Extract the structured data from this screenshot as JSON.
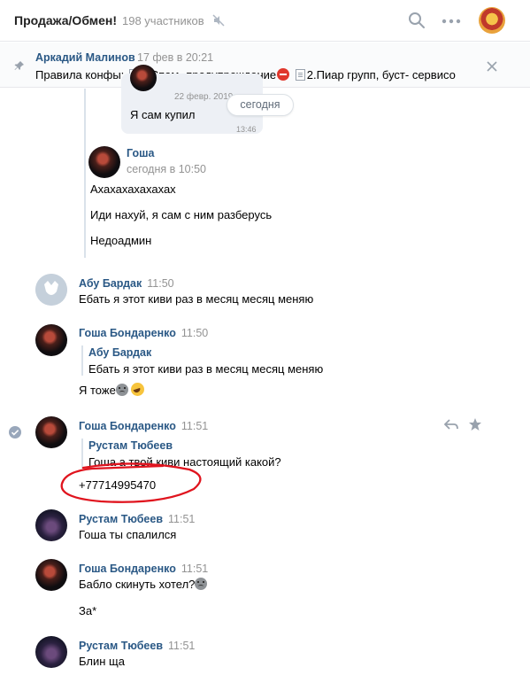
{
  "header": {
    "title": "Продажа/Обмен!",
    "members": "198 участников"
  },
  "pinned": {
    "author": "Аркадий Малинов",
    "date": "17 фев в 20:21",
    "text_prefix": "Правила конфы:",
    "text_part1": "1.Спам- предупреждение",
    "text_part2": "2.Пиар групп, буст- сервисо"
  },
  "quoted_bubble": {
    "date": "22 февр. 2019 г.",
    "text": "Я сам купил",
    "time": "13:46"
  },
  "date_separator": "сегодня",
  "messages": [
    {
      "author": "Гоша",
      "time": "сегодня в 10:50",
      "lines": [
        "Ахахахахахахах",
        "Иди нахуй, я сам с ним разберусь",
        "Недоадмин"
      ]
    },
    {
      "author": "Абу Бардак",
      "time": "11:50",
      "text": "Ебать я этот киви раз в месяц месяц меняю"
    },
    {
      "author": "Гоша Бондаренко",
      "time": "11:50",
      "fwd_author": "Абу Бардак",
      "fwd_text": "Ебать я этот киви раз в месяц месяц меняю",
      "text": "Я тоже"
    },
    {
      "author": "Гоша Бондаренко",
      "time": "11:51",
      "fwd_author": "Рустам Тюбеев",
      "fwd_text": "Гоша а твой киви настоящий какой?",
      "text": "+77714995470"
    },
    {
      "author": "Рустам Тюбеев",
      "time": "11:51",
      "text": "Гоша ты спалился"
    },
    {
      "author": "Гоша Бондаренко",
      "time": "11:51",
      "text": "Бабло скинуть хотел?",
      "text2": "За*"
    },
    {
      "author": "Рустам Тюбеев",
      "time": "11:51",
      "text": "Блин ща"
    }
  ],
  "colors": {
    "link": "#2a5885",
    "muted": "#939393",
    "annotation": "#e0141e"
  }
}
